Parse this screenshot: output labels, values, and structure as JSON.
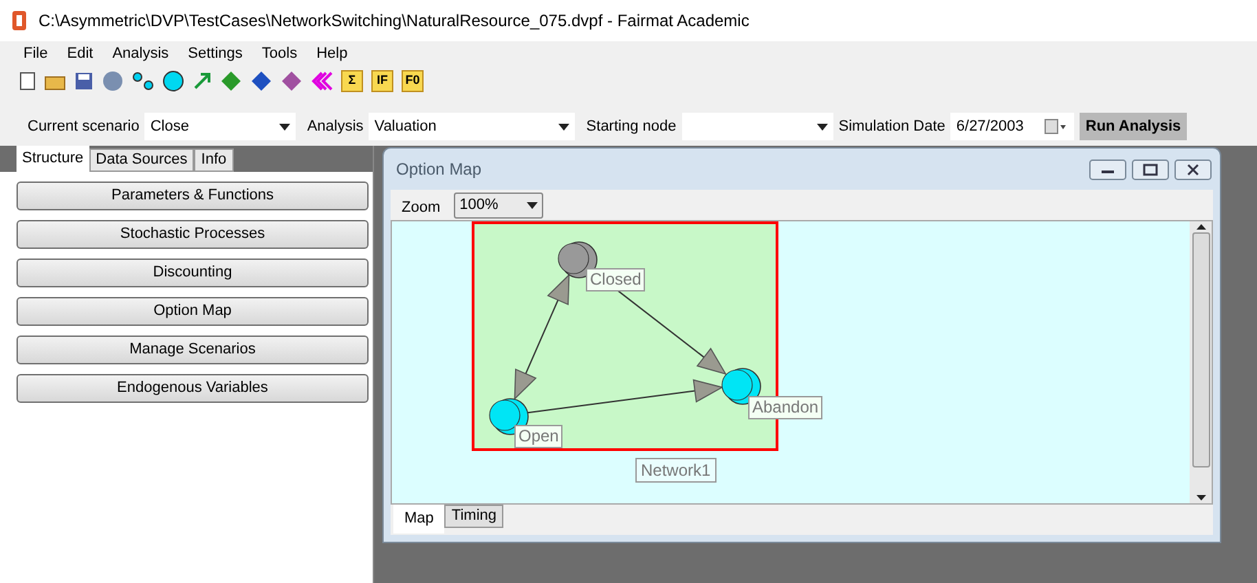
{
  "window": {
    "title": "C:\\Asymmetric\\DVP\\TestCases\\NetworkSwitching\\NaturalResource_075.dvpf - Fairmat Academic"
  },
  "menu": [
    "File",
    "Edit",
    "Analysis",
    "Settings",
    "Tools",
    "Help"
  ],
  "toolbar_labels": [
    "Σ",
    "IF",
    "F0"
  ],
  "scenario_bar": {
    "current_scenario_label": "Current scenario",
    "current_scenario": "Close",
    "analysis_label": "Analysis",
    "analysis": "Valuation",
    "starting_node_label": "Starting node",
    "simulation_date_label": "Simulation Date",
    "simulation_date": "6/27/2003",
    "run_button": "Run Analysis"
  },
  "sidebar": {
    "tabs": [
      {
        "label": "Structure",
        "selected": true
      },
      {
        "label": "Data Sources",
        "selected": false
      },
      {
        "label": "Info",
        "selected": false
      }
    ],
    "buttons": [
      "Parameters & Functions",
      "Stochastic Processes",
      "Discounting",
      "Option Map",
      "Manage Scenarios",
      "Endogenous Variables"
    ]
  },
  "option_map": {
    "title": "Option Map",
    "zoom_label": "Zoom",
    "zoom": "100%",
    "network": "Network1",
    "nodes": [
      {
        "label": "Closed",
        "color": "#999999"
      },
      {
        "label": "Open",
        "color": "#00e5f5"
      },
      {
        "label": "Abandon",
        "color": "#00e5f5"
      }
    ],
    "tabs": [
      {
        "label": "Map",
        "selected": true
      },
      {
        "label": "Timing",
        "selected": false
      }
    ]
  }
}
